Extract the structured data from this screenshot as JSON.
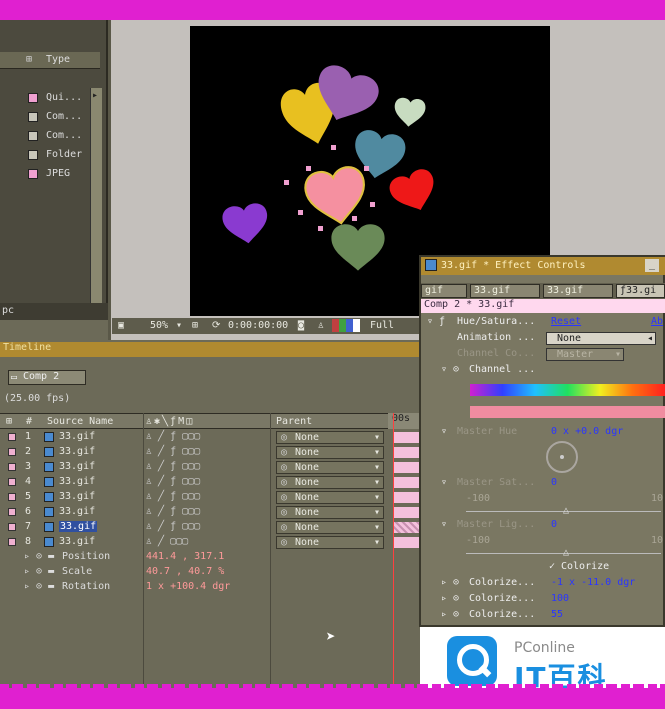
{
  "project": {
    "type_header": "Type",
    "items": [
      {
        "type": "Qui...",
        "color": "#f0a0d0"
      },
      {
        "type": "Com...",
        "color": "#c8c6ba"
      },
      {
        "type": "Com...",
        "color": "#c8c6ba"
      },
      {
        "type": "Folder",
        "color": "#c8c6ba"
      },
      {
        "type": "JPEG",
        "color": "#f0a0d0"
      }
    ],
    "footer": "pc"
  },
  "comp_bar": {
    "zoom": "50%",
    "timecode": "0:00:00:00",
    "resolution": "Full"
  },
  "timeline": {
    "title": "Timeline",
    "tab": "Comp 2",
    "fps": "(25.00 fps)",
    "col_hash": "#",
    "col_source": "Source Name",
    "col_parent": "Parent",
    "ruler": "00s",
    "layers": [
      {
        "num": "1",
        "name": "33.gif",
        "parent": "None"
      },
      {
        "num": "2",
        "name": "33.gif",
        "parent": "None"
      },
      {
        "num": "3",
        "name": "33.gif",
        "parent": "None"
      },
      {
        "num": "4",
        "name": "33.gif",
        "parent": "None"
      },
      {
        "num": "5",
        "name": "33.gif",
        "parent": "None"
      },
      {
        "num": "6",
        "name": "33.gif",
        "parent": "None"
      },
      {
        "num": "7",
        "name": "33.gif",
        "parent": "None"
      },
      {
        "num": "8",
        "name": "33.gif",
        "parent": "None"
      }
    ],
    "properties": [
      {
        "name": "Position",
        "value": "441.4 , 317.1"
      },
      {
        "name": "Scale",
        "value": "40.7 , 40.7 %"
      },
      {
        "name": "Rotation",
        "value": "1 x +100.4 dgr"
      }
    ]
  },
  "effect_controls": {
    "title": "33.gif * Effect Controls",
    "tabs": [
      "gif",
      "33.gif",
      "33.gif",
      "33.gi"
    ],
    "path": "Comp 2 * 33.gif",
    "effect_name": "Hue/Satura...",
    "reset": "Reset",
    "about": "Ab",
    "animation_label": "Animation ...",
    "animation_value": "None",
    "channel_control_label": "Channel Co...",
    "channel_control_value": "Master",
    "channel_range_label": "Channel ...",
    "master_hue_label": "Master Hue",
    "master_hue_value": "0 x +0.0 dgr",
    "master_sat_label": "Master Sat...",
    "master_sat_value": "0",
    "master_sat_min": "-100",
    "master_sat_max": "10",
    "master_lig_label": "Master Lig...",
    "master_lig_value": "0",
    "master_lig_min": "-100",
    "master_lig_max": "10",
    "colorize_check": "Colorize",
    "colorize_rows": [
      {
        "label": "Colorize...",
        "value": "-1 x -11.0 dgr"
      },
      {
        "label": "Colorize...",
        "value": "100"
      },
      {
        "label": "Colorize...",
        "value": "55"
      }
    ]
  },
  "watermark": {
    "small": "PConline",
    "big": "IT百科"
  },
  "colors": {
    "background": "#6c6a58",
    "title_gold": "#b08a30",
    "border_magenta": "#e020d0",
    "link_blue": "#2a36ff"
  }
}
